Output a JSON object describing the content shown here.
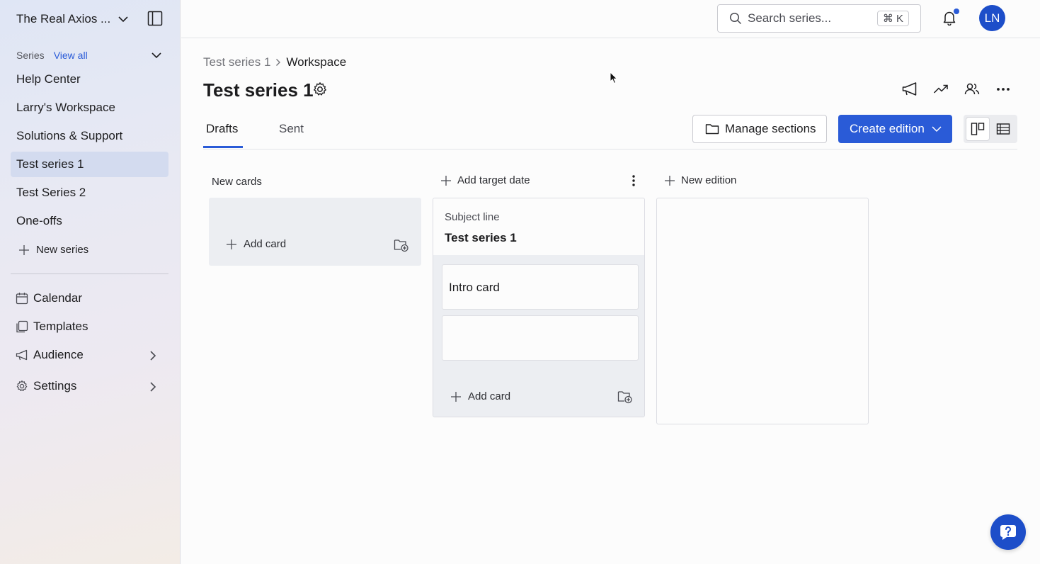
{
  "sidebar": {
    "org_name": "The Real Axios ...",
    "series_label": "Series",
    "view_all": "View all",
    "items": [
      {
        "label": "Help Center"
      },
      {
        "label": "Larry's Workspace"
      },
      {
        "label": "Solutions & Support"
      },
      {
        "label": "Test series 1",
        "active": true
      },
      {
        "label": "Test Series 2"
      },
      {
        "label": "One-offs"
      }
    ],
    "new_series": "New series",
    "links": [
      {
        "label": "Calendar",
        "icon": "calendar-icon"
      },
      {
        "label": "Templates",
        "icon": "templates-icon"
      },
      {
        "label": "Audience",
        "icon": "megaphone-icon"
      },
      {
        "label": "Settings",
        "icon": "gear-icon"
      }
    ]
  },
  "topbar": {
    "search_placeholder": "Search series...",
    "shortcut": "⌘ K",
    "avatar_initials": "LN"
  },
  "header": {
    "breadcrumb": [
      "Test series 1",
      "Workspace"
    ],
    "title": "Test series 1",
    "tabs": [
      "Drafts",
      "Sent"
    ],
    "manage_sections": "Manage sections",
    "create_edition": "Create edition"
  },
  "board": {
    "new_cards_label": "New cards",
    "add_target_date": "Add target date",
    "new_edition": "New edition",
    "add_card": "Add card",
    "edition": {
      "subject_label": "Subject line",
      "subject_value": "Test series 1",
      "cards": [
        "Intro card",
        ""
      ]
    }
  },
  "colors": {
    "accent": "#2a5bd7",
    "avatar": "#1d4ec9",
    "active_nav": "#d3dbef"
  }
}
